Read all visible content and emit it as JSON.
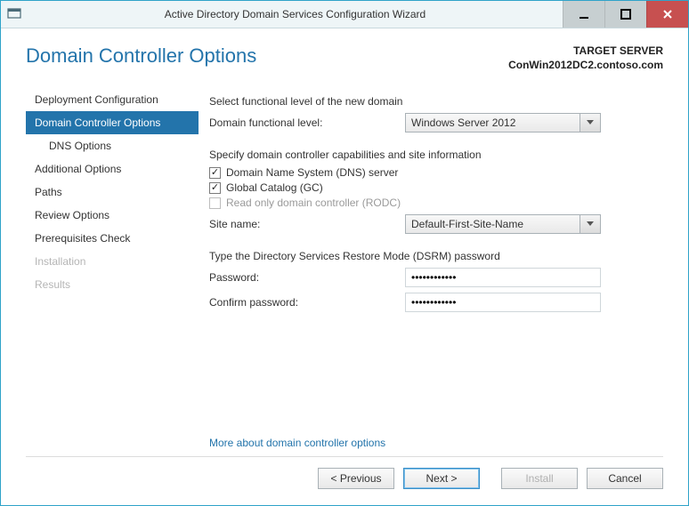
{
  "window": {
    "title": "Active Directory Domain Services Configuration Wizard"
  },
  "header": {
    "page_title": "Domain Controller Options",
    "target_label": "TARGET SERVER",
    "target_host": "ConWin2012DC2.contoso.com"
  },
  "nav": {
    "items": [
      {
        "label": "Deployment Configuration",
        "selected": false,
        "disabled": false,
        "sub": false
      },
      {
        "label": "Domain Controller Options",
        "selected": true,
        "disabled": false,
        "sub": false
      },
      {
        "label": "DNS Options",
        "selected": false,
        "disabled": false,
        "sub": true
      },
      {
        "label": "Additional Options",
        "selected": false,
        "disabled": false,
        "sub": false
      },
      {
        "label": "Paths",
        "selected": false,
        "disabled": false,
        "sub": false
      },
      {
        "label": "Review Options",
        "selected": false,
        "disabled": false,
        "sub": false
      },
      {
        "label": "Prerequisites Check",
        "selected": false,
        "disabled": false,
        "sub": false
      },
      {
        "label": "Installation",
        "selected": false,
        "disabled": true,
        "sub": false
      },
      {
        "label": "Results",
        "selected": false,
        "disabled": true,
        "sub": false
      }
    ]
  },
  "panel": {
    "section1": "Select functional level of the new domain",
    "domain_functional_label": "Domain functional level:",
    "domain_functional_value": "Windows Server 2012",
    "section2": "Specify domain controller capabilities and site information",
    "dns_label": "Domain Name System (DNS) server",
    "gc_label": "Global Catalog (GC)",
    "rodc_label": "Read only domain controller (RODC)",
    "site_name_label": "Site name:",
    "site_name_value": "Default-First-Site-Name",
    "section3": "Type the Directory Services Restore Mode (DSRM) password",
    "password_label": "Password:",
    "password_value": "••••••••••••",
    "confirm_label": "Confirm password:",
    "confirm_value": "••••••••••••",
    "link": "More about domain controller options"
  },
  "buttons": {
    "previous": "< Previous",
    "next": "Next >",
    "install": "Install",
    "cancel": "Cancel"
  }
}
